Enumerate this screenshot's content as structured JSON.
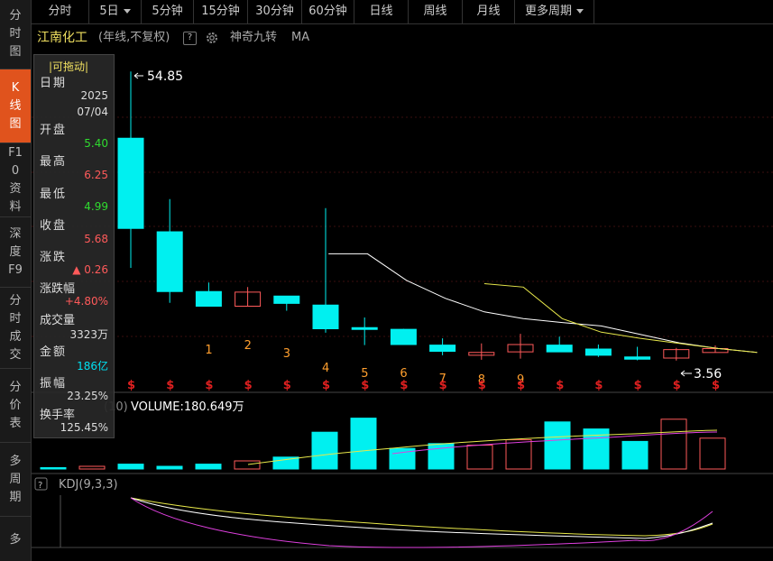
{
  "sidebar": [
    {
      "label": "分时图",
      "active": false
    },
    {
      "label": "K线图",
      "active": true
    },
    {
      "label": "F10资料",
      "active": false
    },
    {
      "label": "深度F9",
      "active": false
    },
    {
      "label": "分时成交",
      "active": false
    },
    {
      "label": "分价表",
      "active": false
    },
    {
      "label": "多周期",
      "active": false
    },
    {
      "label": "多",
      "active": false
    }
  ],
  "toolbar": {
    "items": [
      "分时",
      "5日",
      "5分钟",
      "15分钟",
      "30分钟",
      "60分钟",
      "日线",
      "周线",
      "月线",
      "更多周期"
    ]
  },
  "title": {
    "name": "江南化工",
    "mode": "(年线,不复权)",
    "q": "?",
    "indicator": "神奇九转",
    "ma": "MA"
  },
  "info": {
    "drag": "|可拖动|",
    "date_label": "日期",
    "date_year": "2025",
    "date_md": "07/04",
    "open_label": "开盘",
    "open": "5.40",
    "high_label": "最高",
    "high": "6.25",
    "low_label": "最低",
    "low": "4.99",
    "close_label": "收盘",
    "close": "5.68",
    "change_label": "涨跌",
    "change": "▲ 0.26",
    "pct_label": "涨跌幅",
    "pct": "+4.80%",
    "vol_label": "成交量",
    "vol": "3323万",
    "amount_label": "金额",
    "amount": "186亿",
    "amp_label": "振幅",
    "amp": "23.25%",
    "turnover_label": "换手率",
    "turnover": "125.45%"
  },
  "colors": {
    "up": "#ff5a5a",
    "down": "#00f0f0",
    "green": "#2fdc2f",
    "ma_white": "#ffffff",
    "ma_yellow": "#e8e84a",
    "ma_magenta": "#e040e0",
    "nine": "#ff9f2e",
    "dollar": "#e02020"
  },
  "chart_data": [
    {
      "type": "candlestick",
      "title": "",
      "high_annotation": "54.85",
      "low_annotation": "3.56",
      "nine_turn_labels": [
        "1",
        "2",
        "3",
        "4",
        "5",
        "6",
        "7",
        "8",
        "9"
      ],
      "candles": [
        {
          "o": 43.0,
          "h": 54.85,
          "l": 20.0,
          "c": 27.0
        },
        {
          "o": 26.4,
          "h": 32.2,
          "l": 13.8,
          "c": 15.8
        },
        {
          "o": 15.8,
          "h": 17.4,
          "l": 13.2,
          "c": 13.2
        },
        {
          "o": 13.2,
          "h": 16.6,
          "l": 13.2,
          "c": 15.7
        },
        {
          "o": 15.0,
          "h": 15.0,
          "l": 12.4,
          "c": 13.7
        },
        {
          "o": 13.4,
          "h": 30.6,
          "l": 8.5,
          "c": 9.2
        },
        {
          "o": 9.4,
          "h": 11.2,
          "l": 6.3,
          "c": 9.2
        },
        {
          "o": 9.1,
          "h": 9.2,
          "l": 6.4,
          "c": 6.4
        },
        {
          "o": 6.3,
          "h": 7.5,
          "l": 4.5,
          "c": 5.2
        },
        {
          "o": 4.5,
          "h": 6.6,
          "l": 3.7,
          "c": 5.0
        },
        {
          "o": 5.1,
          "h": 8.3,
          "l": 3.9,
          "c": 6.4
        },
        {
          "o": 6.3,
          "h": 7.8,
          "l": 5.1,
          "c": 5.1
        },
        {
          "o": 5.6,
          "h": 6.4,
          "l": 4.2,
          "c": 4.5
        },
        {
          "o": 4.2,
          "h": 6.0,
          "l": 3.6,
          "c": 3.8
        },
        {
          "o": 4.0,
          "h": 5.8,
          "l": 3.56,
          "c": 5.5
        },
        {
          "o": 4.99,
          "h": 6.25,
          "l": 4.99,
          "c": 5.68
        }
      ],
      "ma_white": [
        null,
        null,
        null,
        null,
        null,
        null,
        22.5,
        22.5,
        17.8,
        14.6,
        12.2,
        11.0,
        10.3,
        9.7,
        8.2,
        6.7,
        5.7,
        5.0
      ],
      "ma_yellow": [
        null,
        null,
        null,
        null,
        null,
        null,
        null,
        null,
        null,
        null,
        17.2,
        16.6,
        11.0,
        8.6,
        7.5,
        6.6,
        5.7,
        5.0
      ],
      "volume_label": "VOLUME:180.649万",
      "volume_prefix": "(10)",
      "volume": [
        0.5,
        1.0,
        1.8,
        1.0,
        1.8,
        3.0,
        4.4,
        13.6,
        18.8,
        7.6,
        9.4,
        8.8,
        10.8,
        17.4,
        14.8,
        10.2,
        18.4,
        11.4
      ],
      "kdj_label": "KDJ(9,3,3)"
    }
  ]
}
